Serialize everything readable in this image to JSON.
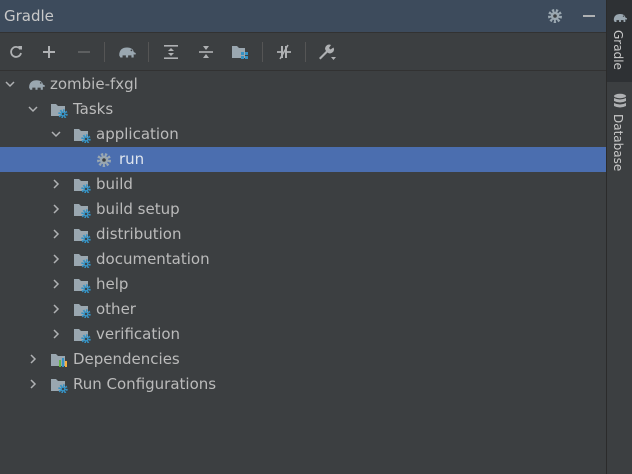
{
  "window": {
    "title": "Gradle"
  },
  "colors": {
    "accent": "#4b6eaf",
    "gear_blue": "#3592c4",
    "folder": "#9aa7b0",
    "elephant": "#9aa7b0"
  },
  "icons": {
    "title_bar": [
      "gear-icon",
      "minimize-icon"
    ],
    "toolbar": [
      "refresh-icon",
      "plus-icon",
      "minus-icon",
      "execute-gradle-task-icon",
      "expand-all-icon",
      "collapse-all-icon",
      "group-tasks-icon",
      "toggle-offline-icon",
      "settings-wrench-icon"
    ]
  },
  "tree": {
    "project": "zombie-fxgl",
    "tasks_label": "Tasks",
    "groups": [
      {
        "label": "application",
        "expanded": true,
        "children": [
          "run"
        ]
      },
      {
        "label": "build",
        "expanded": false
      },
      {
        "label": "build setup",
        "expanded": false
      },
      {
        "label": "distribution",
        "expanded": false
      },
      {
        "label": "documentation",
        "expanded": false
      },
      {
        "label": "help",
        "expanded": false
      },
      {
        "label": "other",
        "expanded": false
      },
      {
        "label": "verification",
        "expanded": false
      }
    ],
    "dependencies_label": "Dependencies",
    "run_configurations_label": "Run Configurations",
    "selected": "run"
  },
  "sidebar": {
    "tabs": [
      {
        "label": "Gradle",
        "active": true
      },
      {
        "label": "Database",
        "active": false
      }
    ]
  }
}
